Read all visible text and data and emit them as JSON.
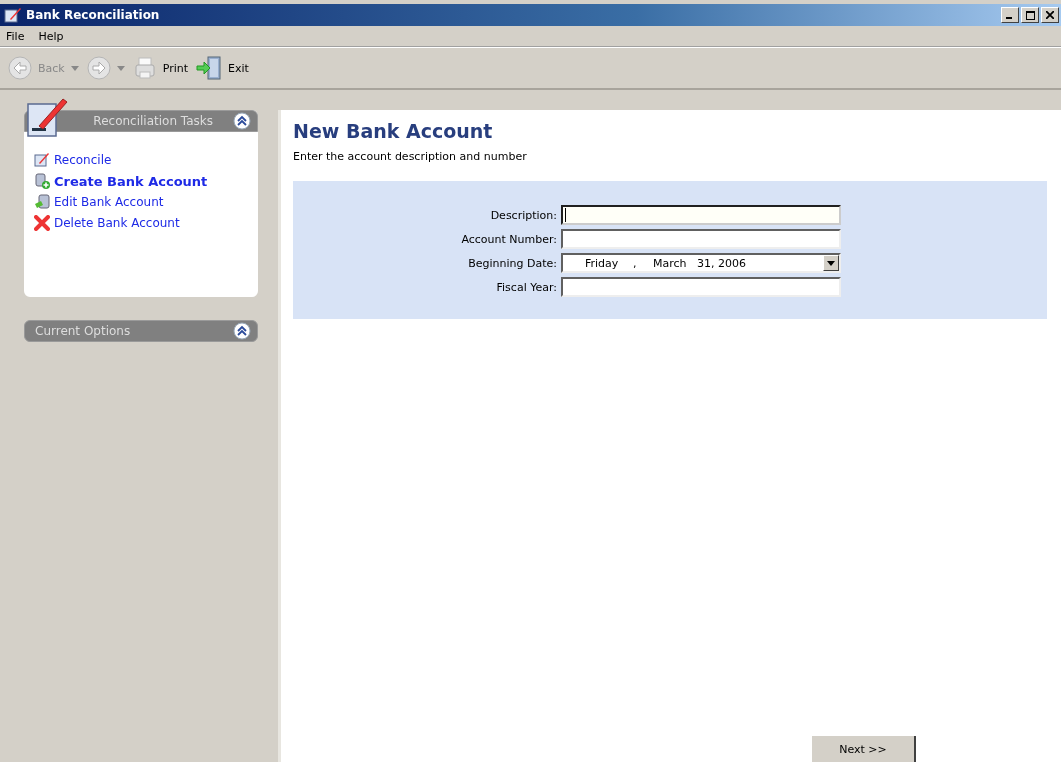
{
  "window": {
    "title": "Bank Reconciliation"
  },
  "menu": [
    {
      "label": "File"
    },
    {
      "label": "Help"
    }
  ],
  "toolbar": [
    {
      "kind": "back",
      "label": "Back",
      "disabled": true,
      "dropdown": true
    },
    {
      "kind": "forward",
      "disabled": true,
      "dropdown": true
    },
    {
      "kind": "print",
      "label": "Print",
      "disabled": false,
      "dropdown": false
    },
    {
      "kind": "exit",
      "label": "Exit",
      "disabled": false,
      "dropdown": false
    }
  ],
  "task_panel": {
    "title": "Reconciliation Tasks",
    "expanded": true,
    "items": [
      {
        "kind": "reconcile",
        "label": "Reconcile",
        "selected": false
      },
      {
        "kind": "create",
        "label": "Create Bank Account",
        "selected": true
      },
      {
        "kind": "edit",
        "label": "Edit Bank Account",
        "selected": false
      },
      {
        "kind": "delete",
        "label": "Delete Bank Account",
        "selected": false
      }
    ]
  },
  "options_panel": {
    "title": "Current Options",
    "expanded": false
  },
  "page": {
    "title": "New Bank Account",
    "subtitle": "Enter the account description and number"
  },
  "form": [
    {
      "kind": "text",
      "label": "Description:",
      "focused": true
    },
    {
      "kind": "text",
      "label": "Account Number:",
      "focused": false
    },
    {
      "kind": "date",
      "label": "Beginning Date:",
      "focused": false,
      "weekday": "Friday",
      "separator": ",",
      "month": "March",
      "day_year": "31, 2006"
    },
    {
      "kind": "text",
      "label": "Fiscal Year:",
      "focused": false
    }
  ],
  "next_button": {
    "label": "Next >>"
  }
}
